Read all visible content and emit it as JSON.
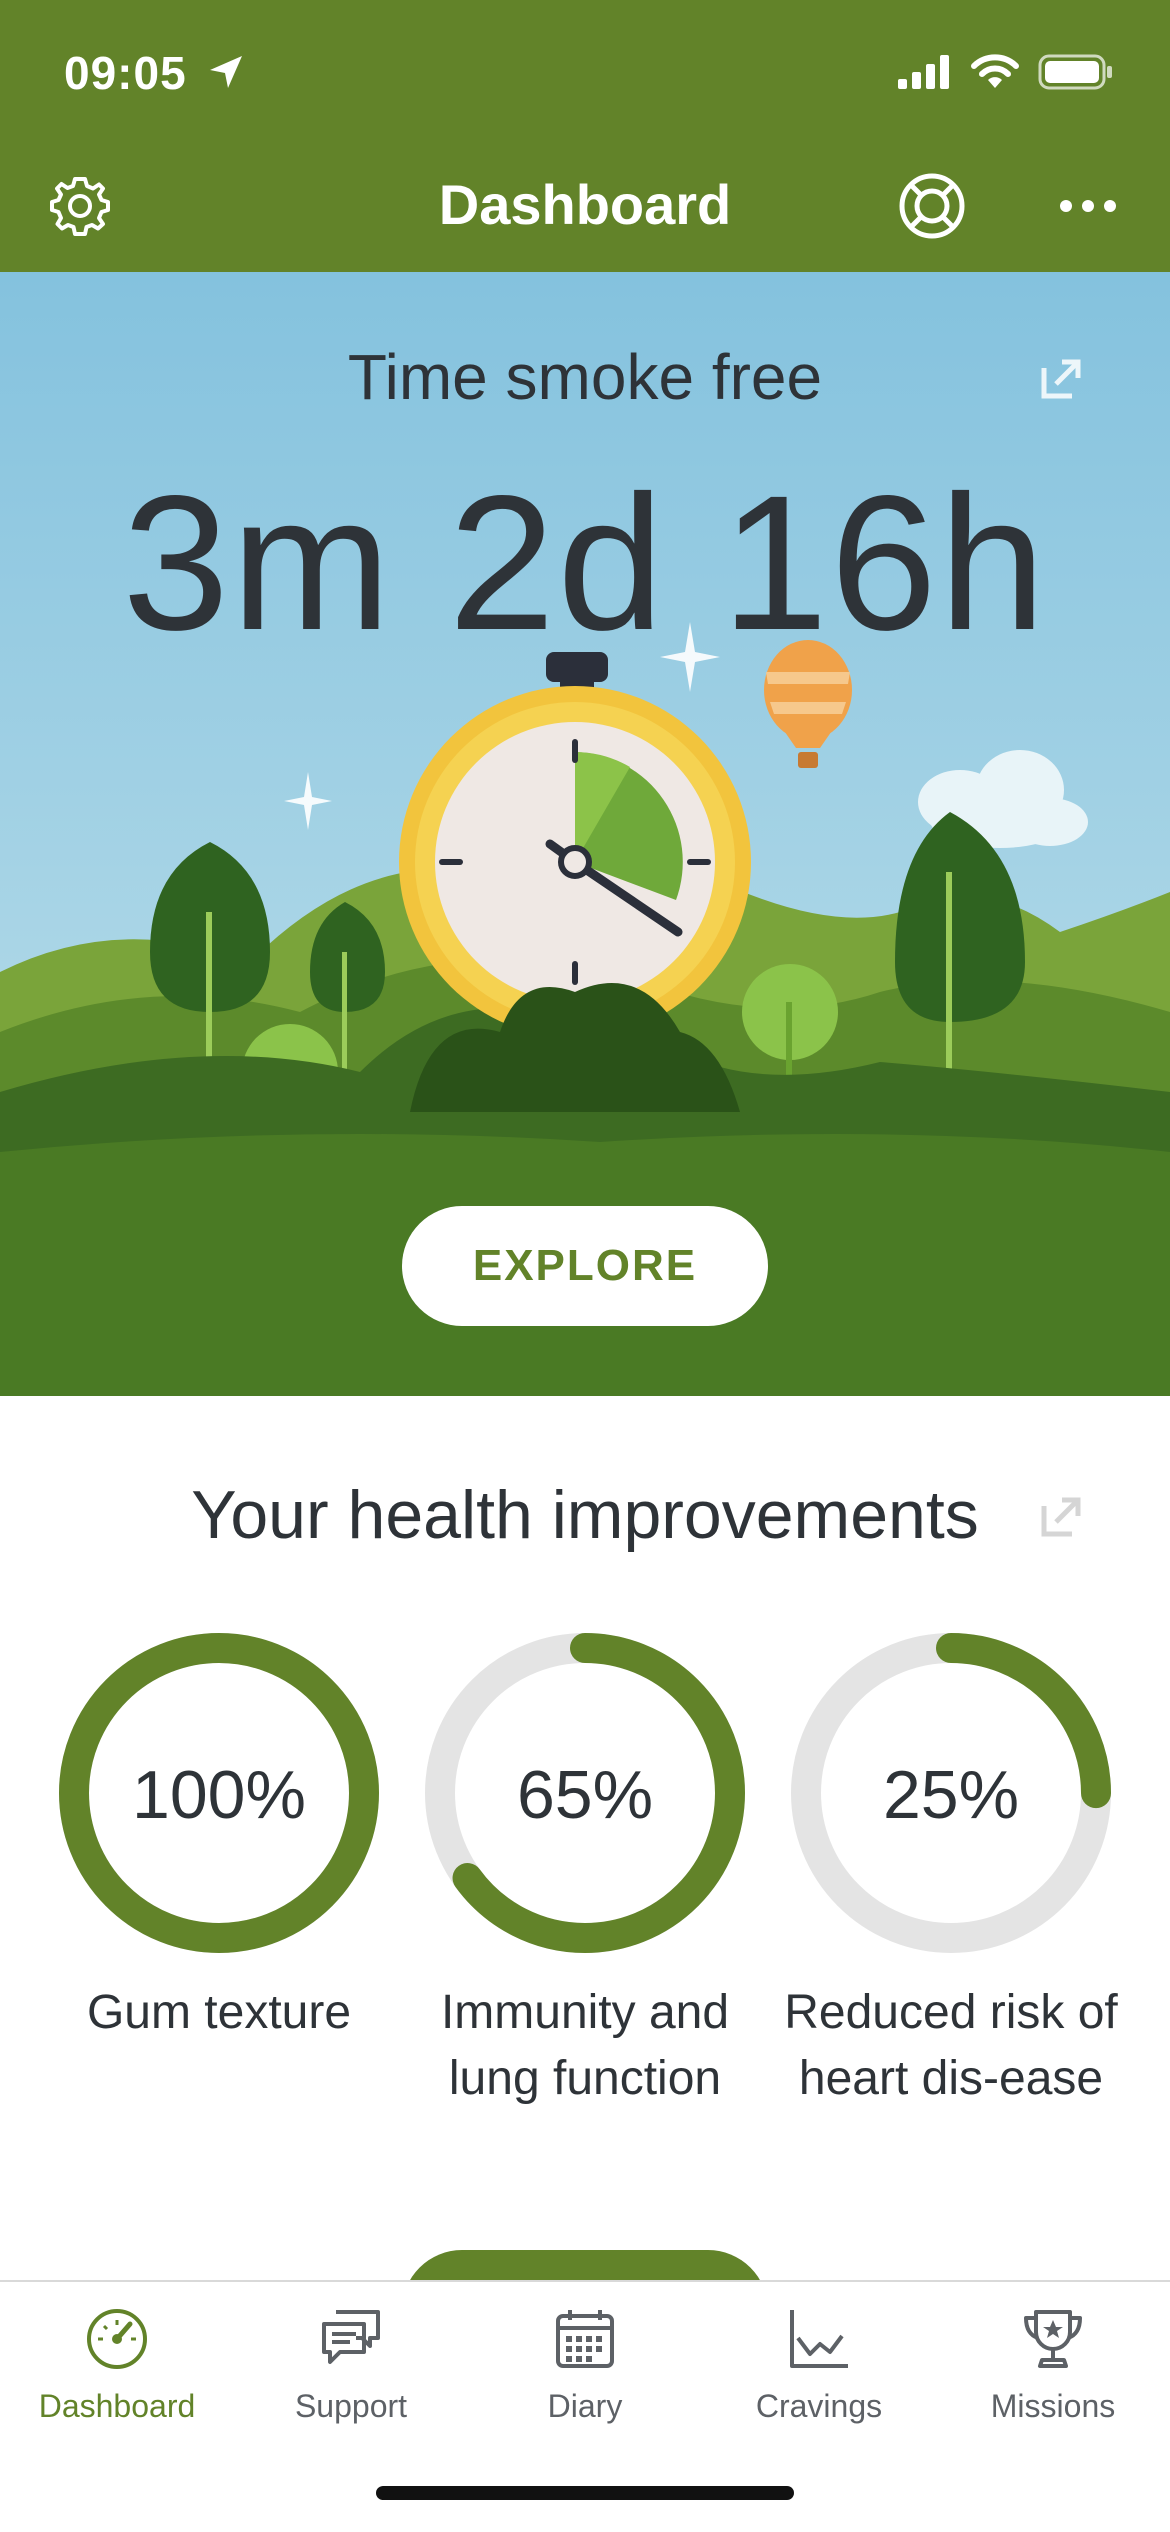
{
  "status_bar": {
    "time": "09:05"
  },
  "header": {
    "title": "Dashboard",
    "icons": [
      "gear-icon",
      "lifebuoy-icon",
      "more-icon"
    ]
  },
  "hero": {
    "title": "Time smoke free",
    "value": "3m 2d 16h",
    "explore_label": "EXPLORE"
  },
  "health": {
    "title": "Your health improvements",
    "items": [
      {
        "percent": "100%",
        "label": "Gum texture",
        "progress": 1.0
      },
      {
        "percent": "65%",
        "label": "Immunity and lung function",
        "progress": 0.65
      },
      {
        "percent": "25%",
        "label": "Reduced risk of heart dis-ease",
        "progress": 0.25
      }
    ]
  },
  "tabs": [
    {
      "label": "Dashboard",
      "icon": "speedometer-icon",
      "active": true
    },
    {
      "label": "Support",
      "icon": "chat-bubbles-icon",
      "active": false
    },
    {
      "label": "Diary",
      "icon": "calendar-icon",
      "active": false
    },
    {
      "label": "Cravings",
      "icon": "chart-icon",
      "active": false
    },
    {
      "label": "Missions",
      "icon": "trophy-icon",
      "active": false
    }
  ],
  "colors": {
    "brand_green": "#628329",
    "ring_track": "#e4e4e4",
    "text_dark": "#2e3338"
  }
}
